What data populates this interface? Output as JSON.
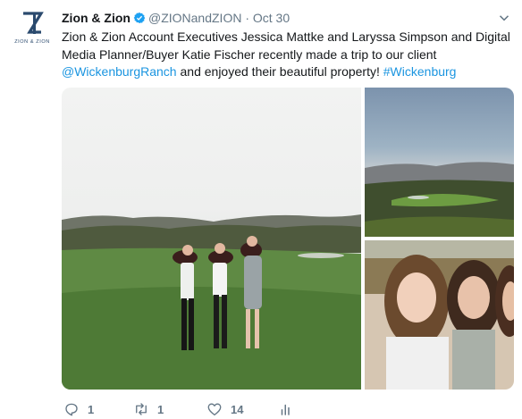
{
  "tweet": {
    "account_name": "Zion & Zion",
    "handle": "@ZIONandZION",
    "separator": "·",
    "date": "Oct 30",
    "avatar_logo_text": "ZION & ZION",
    "text_before": "Zion & Zion Account Executives Jessica Mattke and Laryssa Simpson and Digital Media Planner/Buyer Katie Fischer recently made a trip to our client ",
    "mention": "@WickenburgRanch",
    "text_middle": " and enjoyed their beautiful property! ",
    "hashtag": "#Wickenburg"
  },
  "actions": {
    "reply_count": "1",
    "retweet_count": "1",
    "like_count": "14"
  },
  "colors": {
    "link": "#1b95e0",
    "secondary_text": "#657786",
    "verified": "#1da1f2",
    "brand_logo": "#2b4a6e"
  },
  "icons": [
    "z-logo-icon",
    "verified-badge-icon",
    "chevron-down-icon",
    "reply-icon",
    "retweet-icon",
    "like-icon",
    "analytics-icon"
  ]
}
